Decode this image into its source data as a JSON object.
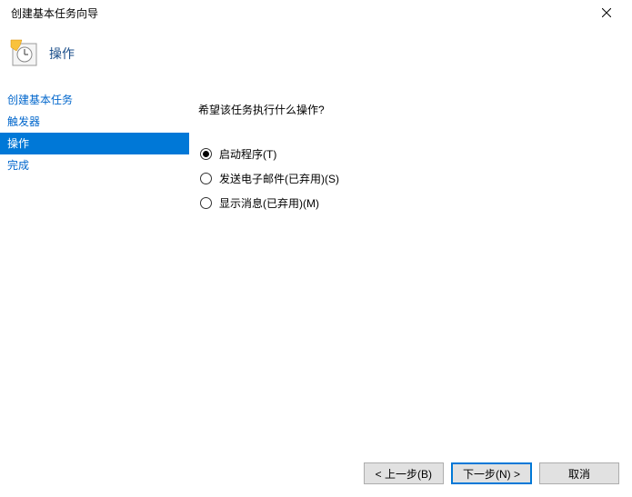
{
  "window": {
    "title": "创建基本任务向导"
  },
  "header": {
    "title": "操作"
  },
  "sidebar": {
    "items": [
      {
        "label": "创建基本任务",
        "selected": false
      },
      {
        "label": "触发器",
        "selected": false
      },
      {
        "label": "操作",
        "selected": true
      },
      {
        "label": "完成",
        "selected": false
      }
    ]
  },
  "content": {
    "prompt": "希望该任务执行什么操作?",
    "options": [
      {
        "label": "启动程序(T)",
        "checked": true
      },
      {
        "label": "发送电子邮件(已弃用)(S)",
        "checked": false
      },
      {
        "label": "显示消息(已弃用)(M)",
        "checked": false
      }
    ]
  },
  "footer": {
    "back": "< 上一步(B)",
    "next": "下一步(N) >",
    "cancel": "取消"
  }
}
